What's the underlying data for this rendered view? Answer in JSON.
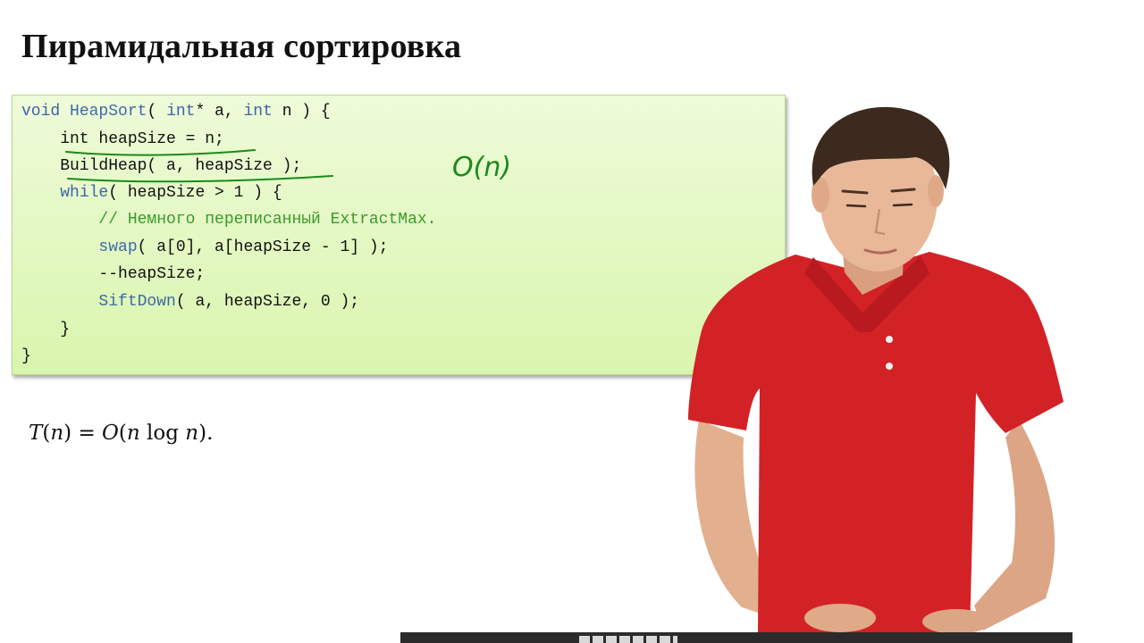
{
  "slide": {
    "title": "Пирамидальная сортировка"
  },
  "code": {
    "line1": {
      "kw_void": "void",
      "fn_name": "HeapSort",
      "p1": "( ",
      "kw_int1": "int",
      "p2": "* a, ",
      "kw_int2": "int",
      "p3": " n ) {"
    },
    "line2": {
      "text": "    int heapSize = n;"
    },
    "line3": {
      "text": "    BuildHeap( a, heapSize );"
    },
    "line4": {
      "indent": "    ",
      "kw_while": "while",
      "rest": "( heapSize > 1 ) {"
    },
    "line5": {
      "indent": "        ",
      "comment": "// Немного переписанный ExtractMax."
    },
    "line6": {
      "indent": "        ",
      "fn_swap": "swap",
      "rest": "( a[0], a[heapSize - 1] );"
    },
    "line7": {
      "text": "        --heapSize;"
    },
    "line8": {
      "indent": "        ",
      "fn_sift": "SiftDown",
      "rest": "( a, heapSize, 0 );"
    },
    "line9": {
      "text": "    }"
    },
    "line10": {
      "text": "}"
    }
  },
  "annotation": {
    "handwritten": "O(n)"
  },
  "formula": {
    "T": "T",
    "n1": "n",
    "eq": ") = ",
    "O": "O",
    "n2": "n",
    "log": " log ",
    "n3": "n",
    "end": ")."
  },
  "colors": {
    "keyword": "#3f63a8",
    "comment": "#3a9a2a",
    "box_background": "#e3f8c2",
    "ink": "#1a8a1a",
    "shirt": "#d32226"
  }
}
